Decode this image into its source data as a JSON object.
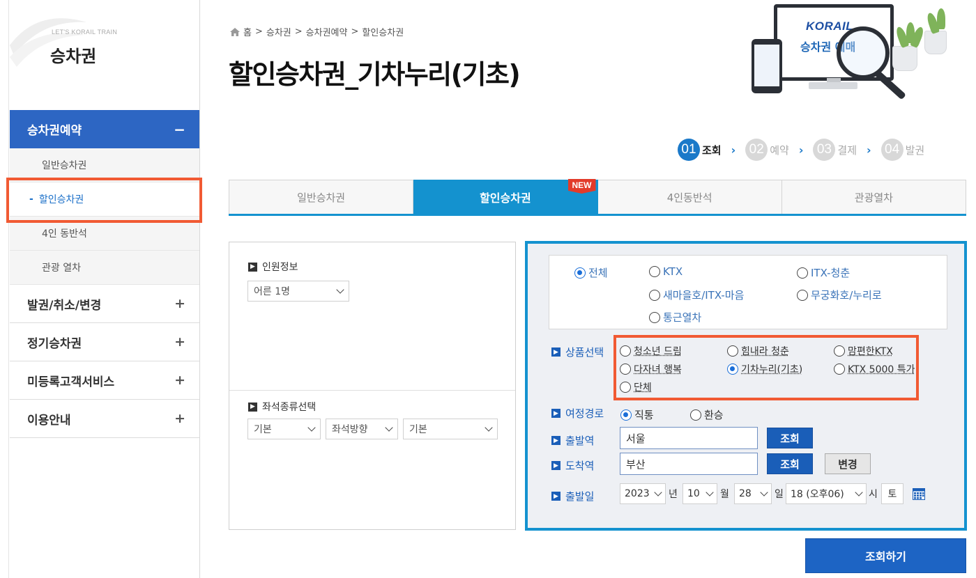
{
  "sidebar": {
    "eyebrow": "LET'S KORAIL TRAIN",
    "title": "승차권",
    "active_group": {
      "label": "승차권예약",
      "symbol": "−"
    },
    "sub_items": [
      {
        "label": "일반승차권"
      },
      {
        "label": "할인승차권",
        "marker": "-"
      },
      {
        "label": "4인 동반석"
      },
      {
        "label": "관광 열차"
      }
    ],
    "groups": [
      {
        "label": "발권/취소/변경",
        "symbol": "+"
      },
      {
        "label": "정기승차권",
        "symbol": "+"
      },
      {
        "label": "미등록고객서비스",
        "symbol": "+"
      },
      {
        "label": "이용안내",
        "symbol": "+"
      }
    ]
  },
  "breadcrumb": {
    "items": [
      "홈",
      "승차권",
      "승차권예약",
      "할인승차권"
    ],
    "separator": ">"
  },
  "page_title": "할인승차권_기차누리(기초)",
  "illustration": {
    "logo": "KORAIL",
    "caption": "승차권 예매"
  },
  "steps": [
    {
      "num": "01",
      "label": "조회",
      "active": true
    },
    {
      "num": "02",
      "label": "예약"
    },
    {
      "num": "03",
      "label": "결제"
    },
    {
      "num": "04",
      "label": "발권"
    }
  ],
  "tabs": [
    {
      "label": "일반승차권"
    },
    {
      "label": "할인승차권",
      "badge": "NEW",
      "active": true
    },
    {
      "label": "4인동반석"
    },
    {
      "label": "관광열차"
    }
  ],
  "passenger": {
    "label": "인원정보",
    "select_value": "어른 1명"
  },
  "seat": {
    "label": "좌석종류선택",
    "selects": [
      "기본",
      "좌석방향",
      "기본"
    ]
  },
  "train_types": {
    "selected": "전체",
    "options": [
      "전체",
      "KTX",
      "ITX-청춘",
      "새마을호/ITX-마음",
      "무궁화호/누리로",
      "통근열차"
    ]
  },
  "product": {
    "label": "상품선택",
    "selected": "기차누리(기초)",
    "options": [
      "청소년 드림",
      "힘내라 청춘",
      "맘편한KTX",
      "다자녀 행복",
      "기차누리(기초)",
      "KTX 5000 특가",
      "단체"
    ]
  },
  "route": {
    "label": "여정경로",
    "options": [
      "직통",
      "환승"
    ],
    "selected": "직통"
  },
  "departure": {
    "label": "출발역",
    "value": "서울",
    "button": "조회"
  },
  "arrival": {
    "label": "도착역",
    "value": "부산",
    "button": "조회",
    "swap_button": "변경"
  },
  "date": {
    "label": "출발일",
    "year": "2023",
    "year_unit": "년",
    "month": "10",
    "month_unit": "월",
    "day": "28",
    "day_unit": "일",
    "hour": "18 (오후06)",
    "hour_unit": "시",
    "weekday": "토",
    "icon": "calendar-icon"
  },
  "search_button": "조회하기",
  "colors": {
    "primary": "#1492cf",
    "nav_active": "#2d66c3",
    "highlight": "#f15a33",
    "button": "#1d64c4"
  }
}
